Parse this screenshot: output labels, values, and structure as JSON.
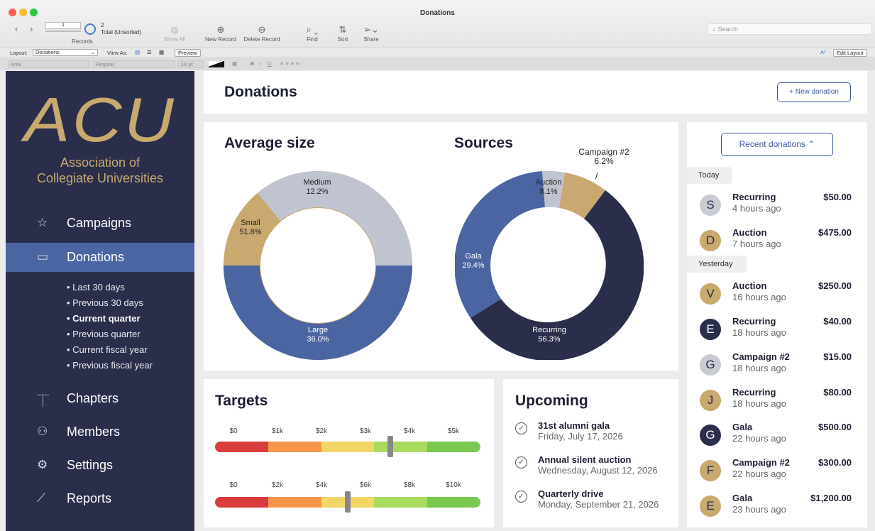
{
  "window": {
    "title": "Donations"
  },
  "toolbar": {
    "record_number": "1",
    "records_count": "2",
    "records_status": "Total (Unsorted)",
    "records_label": "Records",
    "show_all": "Show All",
    "new_record": "New Record",
    "delete_record": "Delete Record",
    "find": "Find",
    "sort": "Sort",
    "share": "Share",
    "search_placeholder": "Search"
  },
  "layoutbar": {
    "layout_label": "Layout:",
    "layout_value": "Donations",
    "view_as": "View As:",
    "preview": "Preview",
    "font_size_icon": "A²",
    "edit_layout": "Edit Layout"
  },
  "formatbar": {
    "font": "Arial",
    "style": "Regular",
    "size": "16 pt",
    "bold": "B",
    "italic": "I",
    "underline": "U"
  },
  "sidebar": {
    "logo": "ACU",
    "org_line1": "Association of",
    "org_line2": "Collegiate Universities",
    "nav": [
      {
        "label": "Campaigns",
        "icon": "star-icon"
      },
      {
        "label": "Donations",
        "icon": "cash-icon"
      },
      {
        "label": "Chapters",
        "icon": "org-chart-icon"
      },
      {
        "label": "Members",
        "icon": "people-icon"
      },
      {
        "label": "Settings",
        "icon": "gear-icon"
      },
      {
        "label": "Reports",
        "icon": "line-chart-icon"
      }
    ],
    "sub": [
      "• Last 30 days",
      "• Previous 30 days",
      "• Current quarter",
      "• Previous quarter",
      "• Current fiscal year",
      "• Previous fiscal year"
    ]
  },
  "header": {
    "title": "Donations",
    "new_button": "+ New donation"
  },
  "average": {
    "title": "Average size",
    "labels": [
      {
        "name": "Medium",
        "pct": "12.2%"
      },
      {
        "name": "Small",
        "pct": "51.8%"
      },
      {
        "name": "Large",
        "pct": "36.0%"
      }
    ]
  },
  "sources": {
    "title": "Sources",
    "labels": [
      {
        "name": "Campaign #2",
        "pct": "6.2%"
      },
      {
        "name": "Auction",
        "pct": "8.1%"
      },
      {
        "name": "Gala",
        "pct": "29.4%"
      },
      {
        "name": "Recurring",
        "pct": "56.3%"
      }
    ]
  },
  "targets": {
    "title": "Targets",
    "bar1": {
      "ticks": [
        "$0",
        "$1k",
        "$2k",
        "$3k",
        "$4k",
        "$5k"
      ],
      "value_fraction": 0.66
    },
    "bar2": {
      "ticks": [
        "$0",
        "$2k",
        "$4k",
        "$6k",
        "$8k",
        "$10k"
      ],
      "value_fraction": 0.5
    }
  },
  "upcoming": {
    "title": "Upcoming",
    "items": [
      {
        "title": "31st alumni gala",
        "date": "Friday, July 17, 2026"
      },
      {
        "title": "Annual silent auction",
        "date": "Wednesday, August 12, 2026"
      },
      {
        "title": "Quarterly drive",
        "date": "Monday, September 21, 2026"
      }
    ]
  },
  "recent": {
    "button": "Recent donations ⌃",
    "today": "Today",
    "yesterday": "Yesterday",
    "items": [
      {
        "initial": "S",
        "type": "Recurring",
        "time": "4 hours ago",
        "amount": "$50.00",
        "color": "#c9cbd3",
        "fg": "#2a2e4b"
      },
      {
        "initial": "D",
        "type": "Auction",
        "time": "7 hours ago",
        "amount": "$475.00",
        "color": "#c8a96e",
        "fg": "#2a2e4b"
      },
      {
        "initial": "V",
        "type": "Auction",
        "time": "16 hours ago",
        "amount": "$250.00",
        "color": "#c8a96e",
        "fg": "#2a2e4b"
      },
      {
        "initial": "E",
        "type": "Recurring",
        "time": "18 hours ago",
        "amount": "$40.00",
        "color": "#2a2e4b",
        "fg": "#ffffff"
      },
      {
        "initial": "G",
        "type": "Campaign #2",
        "time": "18 hours ago",
        "amount": "$15.00",
        "color": "#c9cbd3",
        "fg": "#2a2e4b"
      },
      {
        "initial": "J",
        "type": "Recurring",
        "time": "18 hours ago",
        "amount": "$80.00",
        "color": "#c8a96e",
        "fg": "#2a2e4b"
      },
      {
        "initial": "G",
        "type": "Gala",
        "time": "22 hours ago",
        "amount": "$500.00",
        "color": "#2a2e4b",
        "fg": "#ffffff"
      },
      {
        "initial": "F",
        "type": "Campaign #2",
        "time": "22 hours ago",
        "amount": "$300.00",
        "color": "#c8a96e",
        "fg": "#2a2e4b"
      },
      {
        "initial": "E",
        "type": "Gala",
        "time": "23 hours ago",
        "amount": "$1,200.00",
        "color": "#c8a96e",
        "fg": "#2a2e4b"
      }
    ]
  },
  "colors": {
    "navy": "#2a2e4b",
    "gold": "#c8a96e",
    "blue": "#4a65a1",
    "gray": "#c0c4d0"
  }
}
